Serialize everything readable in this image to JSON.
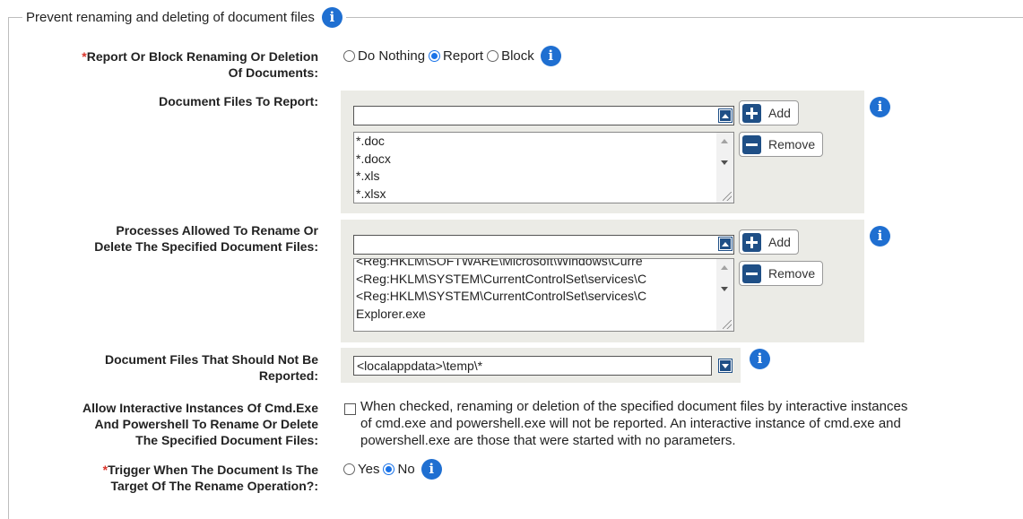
{
  "section": {
    "title": "Prevent renaming and deleting of document files"
  },
  "report_or_block": {
    "required_mark": "*",
    "label_line1": "Report Or Block Renaming Or Deletion",
    "label_line2": "Of Documents:",
    "options": [
      {
        "label": "Do Nothing",
        "checked": false
      },
      {
        "label": "Report",
        "checked": true
      },
      {
        "label": "Block",
        "checked": false
      }
    ]
  },
  "document_files_to_report": {
    "label": "Document Files To Report:",
    "input_value": "",
    "items": [
      "*.doc",
      "*.docx",
      "*.xls",
      "*.xlsx"
    ],
    "add_label": "Add",
    "remove_label": "Remove"
  },
  "processes_allowed": {
    "label_line1": "Processes Allowed To Rename Or",
    "label_line2": "Delete The Specified Document Files:",
    "input_value": "",
    "items": [
      "<Reg:HKLM\\SOFTWARE\\Microsoft\\Windows\\Curre",
      "<Reg:HKLM\\SYSTEM\\CurrentControlSet\\services\\C",
      "<Reg:HKLM\\SYSTEM\\CurrentControlSet\\services\\C",
      "Explorer.exe"
    ],
    "add_label": "Add",
    "remove_label": "Remove"
  },
  "not_reported": {
    "label_line1": "Document Files That Should Not Be",
    "label_line2": "Reported:",
    "value": "<localappdata>\\temp\\*"
  },
  "allow_interactive": {
    "label_line1": "Allow Interactive Instances Of Cmd.Exe",
    "label_line2": "And Powershell To Rename Or Delete",
    "label_line3": "The Specified Document Files:",
    "checked": false,
    "desc_line1": "When checked, renaming or deletion of the specified document files by interactive instances",
    "desc_line2": "of cmd.exe and powershell.exe will not be reported. An interactive instance of cmd.exe and",
    "desc_line3": "powershell.exe are those that were started with no parameters."
  },
  "trigger_target": {
    "required_mark": "*",
    "label_line1": "Trigger When The Document Is The",
    "label_line2": "Target Of The Rename Operation?:",
    "options": [
      {
        "label": "Yes",
        "checked": false
      },
      {
        "label": "No",
        "checked": true
      }
    ]
  },
  "icons": {
    "info": "info-icon",
    "expand_up": "arrow-up-icon",
    "expand_down": "arrow-down-icon",
    "add": "plus-icon",
    "remove": "minus-icon"
  },
  "colors": {
    "accent": "#1f4f86",
    "info": "#1f6fd1",
    "required": "#d9342b",
    "panel": "#ebebe6"
  }
}
